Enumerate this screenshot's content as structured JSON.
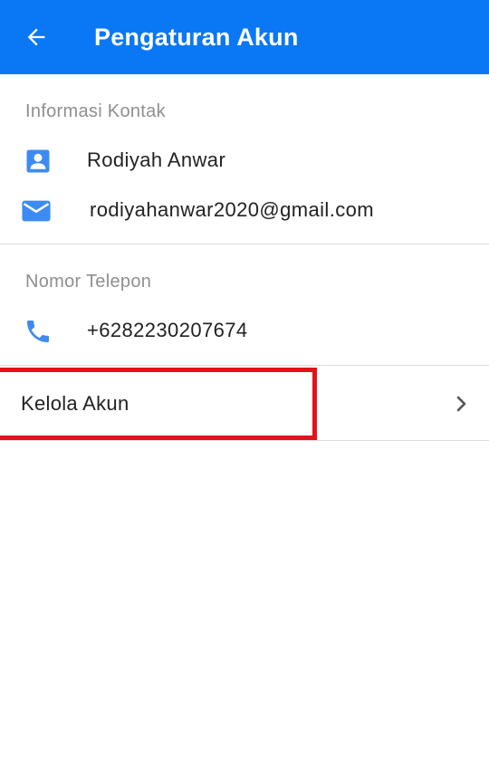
{
  "header": {
    "title": "Pengaturan Akun",
    "back_icon": "arrow-left-icon",
    "background_color": "#0a78f5"
  },
  "contact_section": {
    "heading": "Informasi Kontak",
    "name": "Rodiyah Anwar",
    "name_icon": "person-icon",
    "email": "rodiyahanwar2020@gmail.com",
    "email_icon": "mail-icon"
  },
  "phone_section": {
    "heading": "Nomor Telepon",
    "phone": "+6282230207674",
    "phone_icon": "phone-icon"
  },
  "menu": {
    "manage_account_label": "Kelola Akun",
    "chevron_icon": "chevron-right-icon"
  },
  "colors": {
    "icon_blue": "#3d8bf2",
    "highlight_red": "#e3121b",
    "section_gray": "#8f8f8f"
  }
}
